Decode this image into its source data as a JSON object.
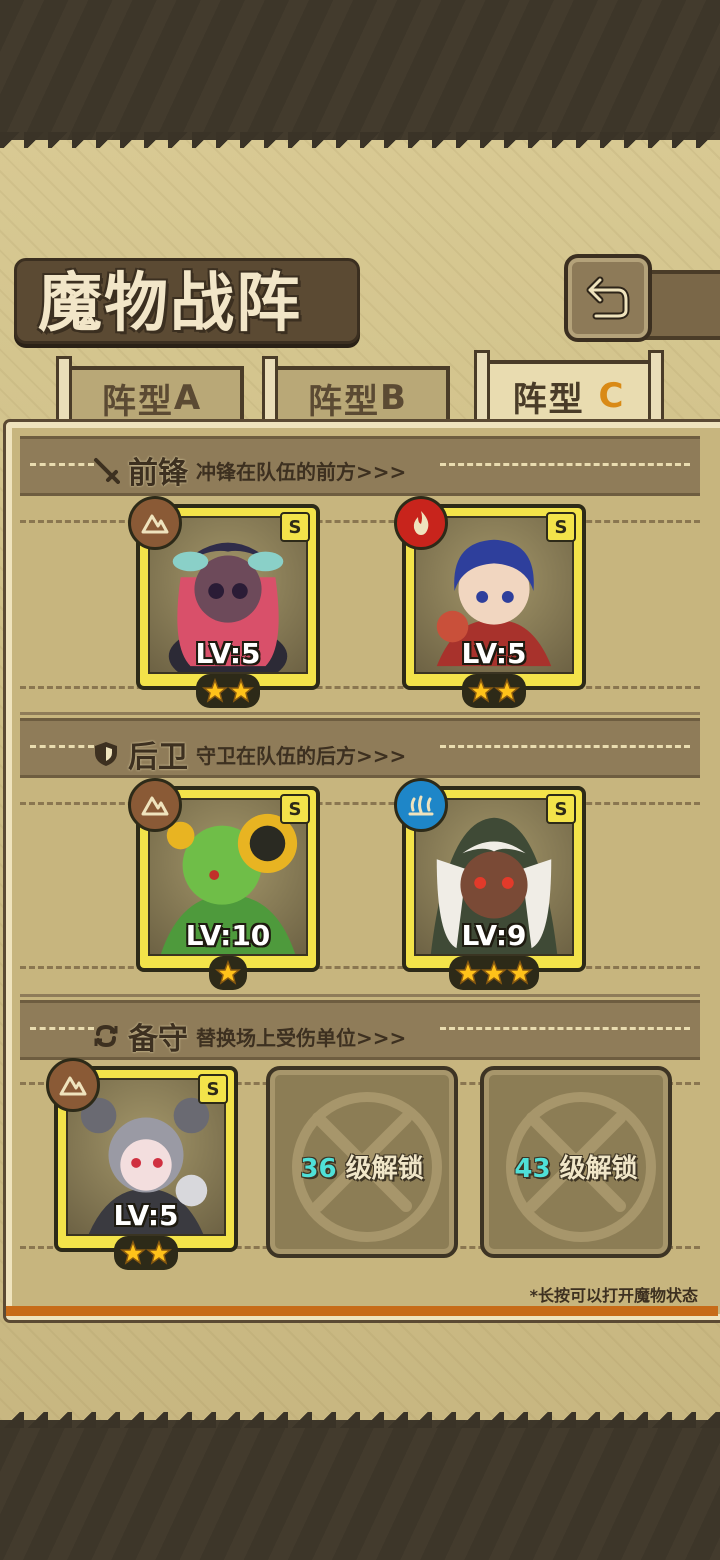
{
  "title": "魔物战阵",
  "tabs": [
    {
      "prefix": "阵型",
      "letter": "A",
      "active": false
    },
    {
      "prefix": "阵型",
      "letter": "B",
      "active": false
    },
    {
      "prefix": "阵型",
      "letter": "C",
      "active": true
    }
  ],
  "sections": {
    "front": {
      "name": "前锋",
      "desc": "冲锋在队伍的前方>>>",
      "icon": "sword-icon"
    },
    "rear": {
      "name": "后卫",
      "desc": "守卫在队伍的后方>>>",
      "icon": "shield-icon"
    },
    "reserve": {
      "name": "备守",
      "desc": "替换场上受伤单位>>>",
      "icon": "swap-icon"
    }
  },
  "cards": {
    "front1": {
      "rank": "S",
      "element": "earth",
      "level": "LV:5",
      "stars": 2
    },
    "front2": {
      "rank": "S",
      "element": "fire",
      "level": "LV:5",
      "stars": 2
    },
    "rear1": {
      "rank": "S",
      "element": "earth",
      "level": "LV:10",
      "stars": 1
    },
    "rear2": {
      "rank": "S",
      "element": "water",
      "level": "LV:9",
      "stars": 3
    },
    "reserve1": {
      "rank": "S",
      "element": "earth",
      "level": "LV:5",
      "stars": 2
    }
  },
  "locked_slots": [
    {
      "level": "36",
      "text": "级解锁"
    },
    {
      "level": "43",
      "text": "级解锁"
    }
  ],
  "hint": "*长按可以打开魔物状态",
  "colors": {
    "earth": "#8a5a36",
    "fire": "#c8241c",
    "water": "#1e86c8",
    "active_letter": "#d98a16"
  }
}
